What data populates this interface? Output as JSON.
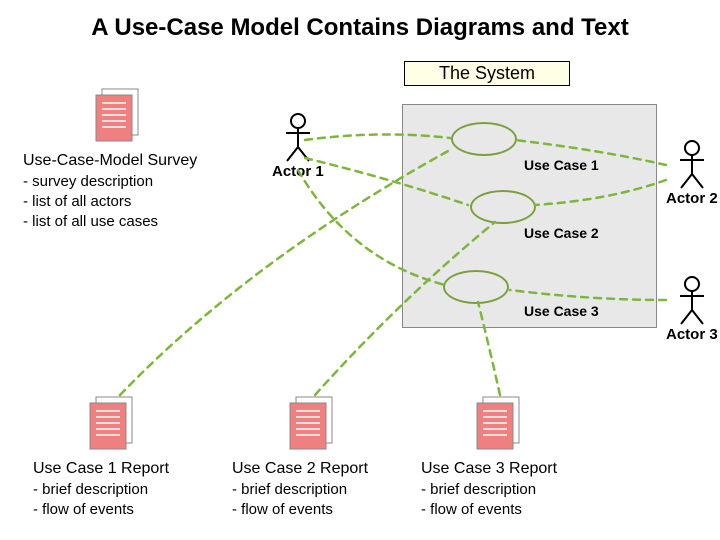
{
  "title": "A Use-Case Model Contains Diagrams and Text",
  "system_label": "The System",
  "actors": {
    "a1": "Actor 1",
    "a2": "Actor 2",
    "a3": "Actor 3"
  },
  "usecases": {
    "uc1": "Use Case 1",
    "uc2": "Use Case 2",
    "uc3": "Use Case 3"
  },
  "survey": {
    "head": "Use-Case-Model Survey",
    "line1": " - survey description",
    "line2": " - list of all actors",
    "line3": " - list of all use cases"
  },
  "reports": {
    "r1": {
      "head": "Use Case 1 Report",
      "line1": " - brief description",
      "line2": " - flow of events"
    },
    "r2": {
      "head": "Use Case 2 Report",
      "line1": " - brief description",
      "line2": " - flow of events"
    },
    "r3": {
      "head": "Use Case 3 Report",
      "line1": " - brief description",
      "line2": " - flow of events"
    }
  },
  "colors": {
    "dash": "#7db63a",
    "doc_fill": "#f08080",
    "doc_stroke": "#808080",
    "system_bg": "#e8e8e8",
    "system_label_bg": "#ffffe6"
  }
}
